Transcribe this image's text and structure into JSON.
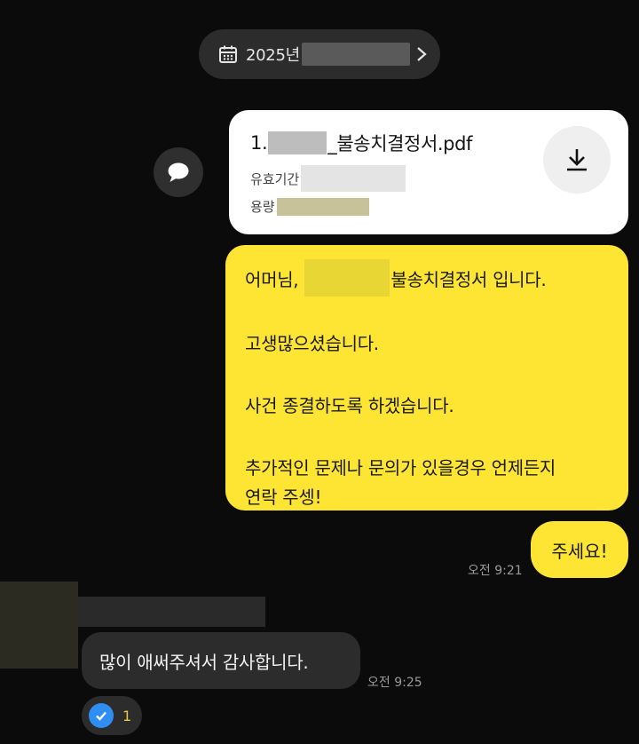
{
  "date_divider": {
    "text": "2025년",
    "icon": "calendar-icon",
    "chevron": "chevron-right-icon"
  },
  "share_button": {
    "icon": "speech-bubble-icon"
  },
  "file_card": {
    "name_prefix": "1.",
    "name_suffix": "_불송치결정서.pdf",
    "validity_label": "유효기간",
    "size_label": "용량",
    "download_icon": "download-icon"
  },
  "outgoing_message": {
    "line1_prefix": "어머님,",
    "line1_suffix": "불송치결정서 입니다.",
    "line2": "고생많으셨습니다.",
    "line3": "사건 종결하도록 하겠습니다.",
    "line4": "추가적인 문제나 문의가 있을경우 언제든지",
    "line5": "연락 주셍!"
  },
  "outgoing_short": {
    "text": "주세요!",
    "time": "오전 9:21"
  },
  "incoming_message": {
    "text": "많이 애써주셔서 감사합니다.",
    "time": "오전 9:25"
  },
  "reaction": {
    "icon": "check-icon",
    "count": "1"
  },
  "colors": {
    "background": "#0b0b0b",
    "outgoing_bubble": "#fee534",
    "incoming_bubble": "#2c2c2c",
    "reaction_check": "#2f8ef4"
  }
}
